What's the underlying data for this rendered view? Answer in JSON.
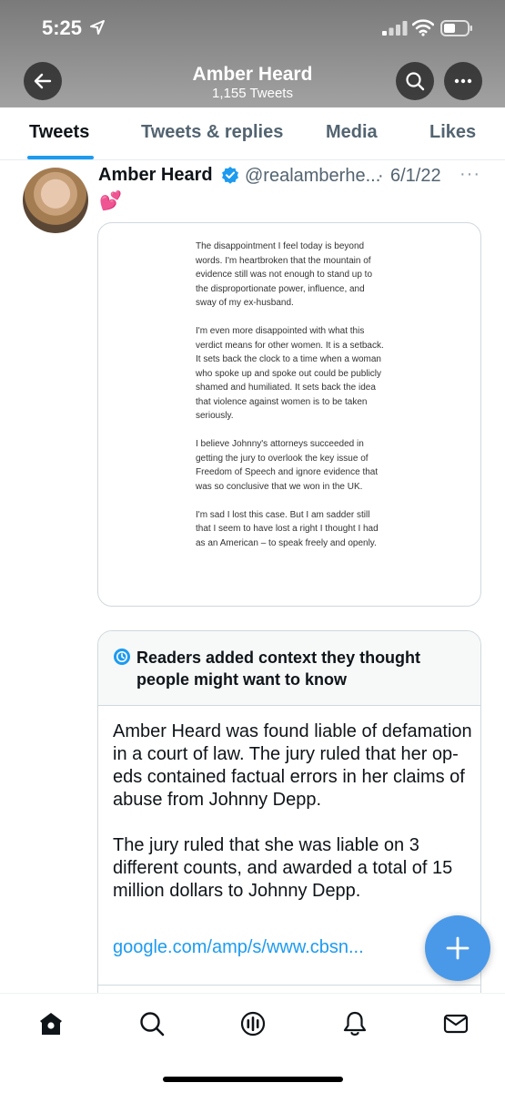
{
  "status_bar": {
    "time": "5:25"
  },
  "header": {
    "title": "Amber Heard",
    "subtitle": "1,155 Tweets"
  },
  "icons": {
    "back": "back-arrow-icon",
    "search": "search-icon",
    "more": "more-icon",
    "verified": "verified-badge-icon",
    "note": "community-notes-icon",
    "compose": "plus-icon",
    "nav": [
      "home-icon",
      "search-icon",
      "spaces-icon",
      "notifications-icon",
      "messages-icon"
    ]
  },
  "tabs": [
    {
      "label": "Tweets",
      "active": true
    },
    {
      "label": "Tweets & replies",
      "active": false
    },
    {
      "label": "Media",
      "active": false
    },
    {
      "label": "Likes",
      "active": false
    }
  ],
  "tweet": {
    "author_name": "Amber Heard",
    "handle": "@realamberhe...",
    "separator": "·",
    "date": "6/1/22",
    "more": "···",
    "text": "💕",
    "image_text": [
      "The disappointment I feel today is beyond words. I'm heartbroken that the mountain of evidence still was not enough to stand up to the disproportionate power, influence, and sway of my ex-husband.",
      "I'm even more disappointed with what this verdict means for other women. It is a setback. It sets back the clock to a time when a woman who spoke up and spoke out could be publicly shamed and humiliated. It sets back the idea that violence against women is to be taken seriously.",
      "I believe Johnny's attorneys succeeded in getting the jury to overlook the key issue of Freedom of Speech and ignore evidence that was so conclusive that we won in the UK.",
      "I'm sad I lost this case. But I am sadder still that I seem to have lost a right I thought I had as an American – to speak freely and openly."
    ]
  },
  "community_note": {
    "title": "Readers added context they thought people might want to know",
    "body": [
      "Amber Heard was found liable of defamation in a court of law. The jury ruled that her op-eds contained factual errors in her claims of abuse from Johnny Depp.",
      "The jury ruled that she was liable on 3 different counts, and awarded a total of 15 million dollars to Johnny Depp."
    ],
    "link": "google.com/amp/s/www.cbsn..."
  },
  "colors": {
    "accent": "#1d9bf0",
    "fab": "#4a99e9",
    "secondary_text": "#536471"
  }
}
